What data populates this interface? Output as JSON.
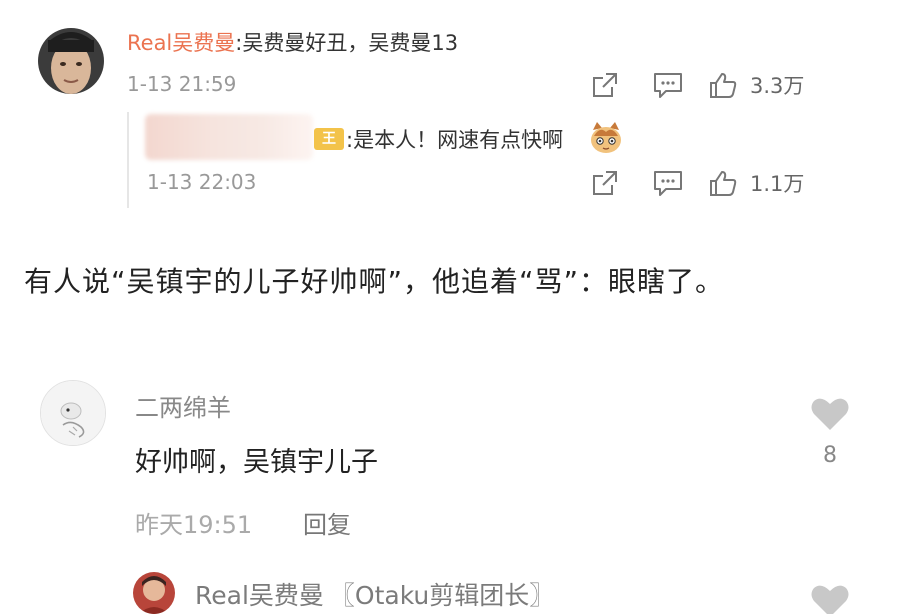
{
  "top_comment": {
    "author": "Real吴费曼",
    "text": ":吴费曼好丑，吴费曼13",
    "time": "1-13 21:59",
    "like_count": "3.3万",
    "icons": [
      "share-icon",
      "comment-icon",
      "like-icon"
    ]
  },
  "nested_reply": {
    "badge": "王",
    "text": ":是本人！网速有点快啊",
    "time": "1-13 22:03",
    "like_count": "1.1万",
    "icons": [
      "share-icon",
      "comment-icon",
      "like-icon",
      "cat-emoji-icon"
    ]
  },
  "caption": "有人说“吴镇宇的儿子好帅啊”，他追着“骂”：眼瞎了。",
  "comment2": {
    "author": "二两绵羊",
    "text": "好帅啊，吴镇宇儿子",
    "time": "昨天19:51",
    "reply_label": "回复",
    "like_count": "8",
    "icons": [
      "heart-icon"
    ]
  },
  "reply2": {
    "author": "Real吴费曼",
    "tag": "〖Otaku剪辑团长〗",
    "icons": [
      "heart-icon"
    ]
  },
  "colors": {
    "username_accent": "#eb7350",
    "badge_gold": "#f3c34a",
    "heart_gray": "#c8c8c8"
  }
}
